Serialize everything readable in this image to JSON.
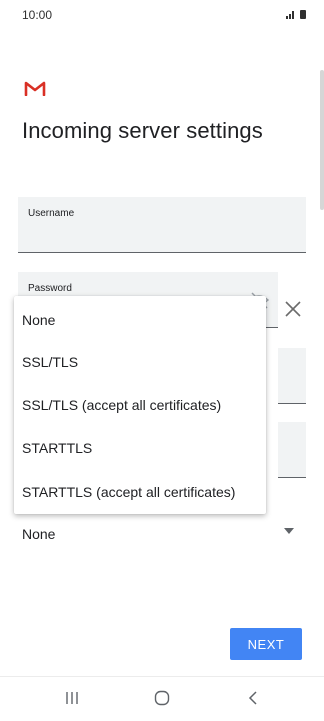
{
  "status_bar": {
    "time": "10:00"
  },
  "header": {
    "title": "Incoming server settings"
  },
  "form": {
    "username": {
      "label": "Username",
      "value": ""
    },
    "password": {
      "label": "Password",
      "value": ""
    }
  },
  "security_dropdown": {
    "options": [
      "None",
      "SSL/TLS",
      "SSL/TLS (accept all certificates)",
      "STARTTLS",
      "STARTTLS (accept all certificates)"
    ],
    "selected": "None"
  },
  "footer": {
    "next_label": "NEXT"
  },
  "colors": {
    "accent": "#4285f4",
    "field_bg": "#f1f3f4",
    "gmail_red": "#d93025"
  },
  "icons": [
    "signal-icon",
    "battery-icon",
    "gmail-logo-icon",
    "eye-icon",
    "close-icon",
    "caret-down-icon",
    "nav-recents-icon",
    "nav-home-icon",
    "nav-back-icon"
  ]
}
